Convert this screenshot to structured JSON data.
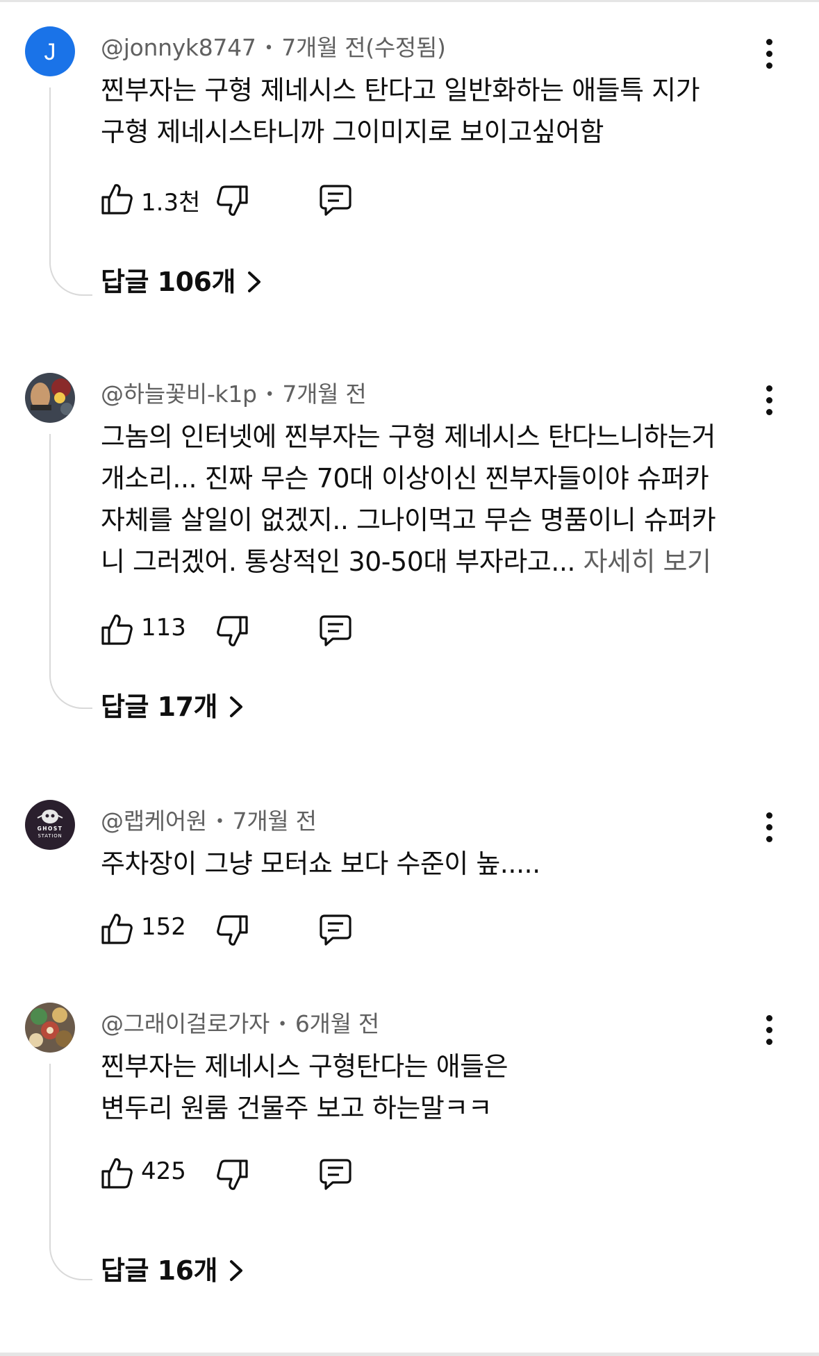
{
  "comments": [
    {
      "author": "@jonnyk8747",
      "time": "7개월 전(수정됨)",
      "avatar_letter": "J",
      "avatar_color": "#1a73e8",
      "text_lines": [
        "찐부자는 구형 제네시스 탄다고 일반화하는 애들특 지가",
        "구형 제네시스타니까 그이미지로 보이고싶어함"
      ],
      "likes": "1.3천",
      "replies": "답글 106개"
    },
    {
      "author": "@하늘꽃비-k1p",
      "time": "7개월 전",
      "text_lines": [
        "그놈의 인터넷에 찐부자는 구형 제네시스 탄다느니하는거",
        "개소리... 진짜 무슨 70대 이상이신 찐부자들이야 슈퍼카",
        "자체를 살일이 없겠지.. 그나이먹고 무슨 명품이니 슈퍼카",
        "니 그러겠어. 통상적인 30-50대 부자라고..."
      ],
      "more": "자세히 보기",
      "likes": "113",
      "replies": "답글 17개"
    },
    {
      "author": "@랩케어원",
      "time": "7개월 전",
      "avatar_text": [
        "GHOST",
        "STATION"
      ],
      "text_lines": [
        "주차장이 그냥 모터쇼 보다 수준이 높....."
      ],
      "likes": "152"
    },
    {
      "author": "@그래이걸로가자",
      "time": "6개월 전",
      "text_lines": [
        "찐부자는 제네시스 구형탄다는 애들은",
        "변두리 원룸 건물주 보고 하는말ㅋㅋ"
      ],
      "likes": "425",
      "replies": "답글 16개"
    }
  ],
  "icons": {
    "like": "thumbs-up-icon",
    "dislike": "thumbs-down-icon",
    "reply": "comment-icon",
    "more": "more-vertical-icon",
    "chevron": "chevron-right-icon"
  }
}
